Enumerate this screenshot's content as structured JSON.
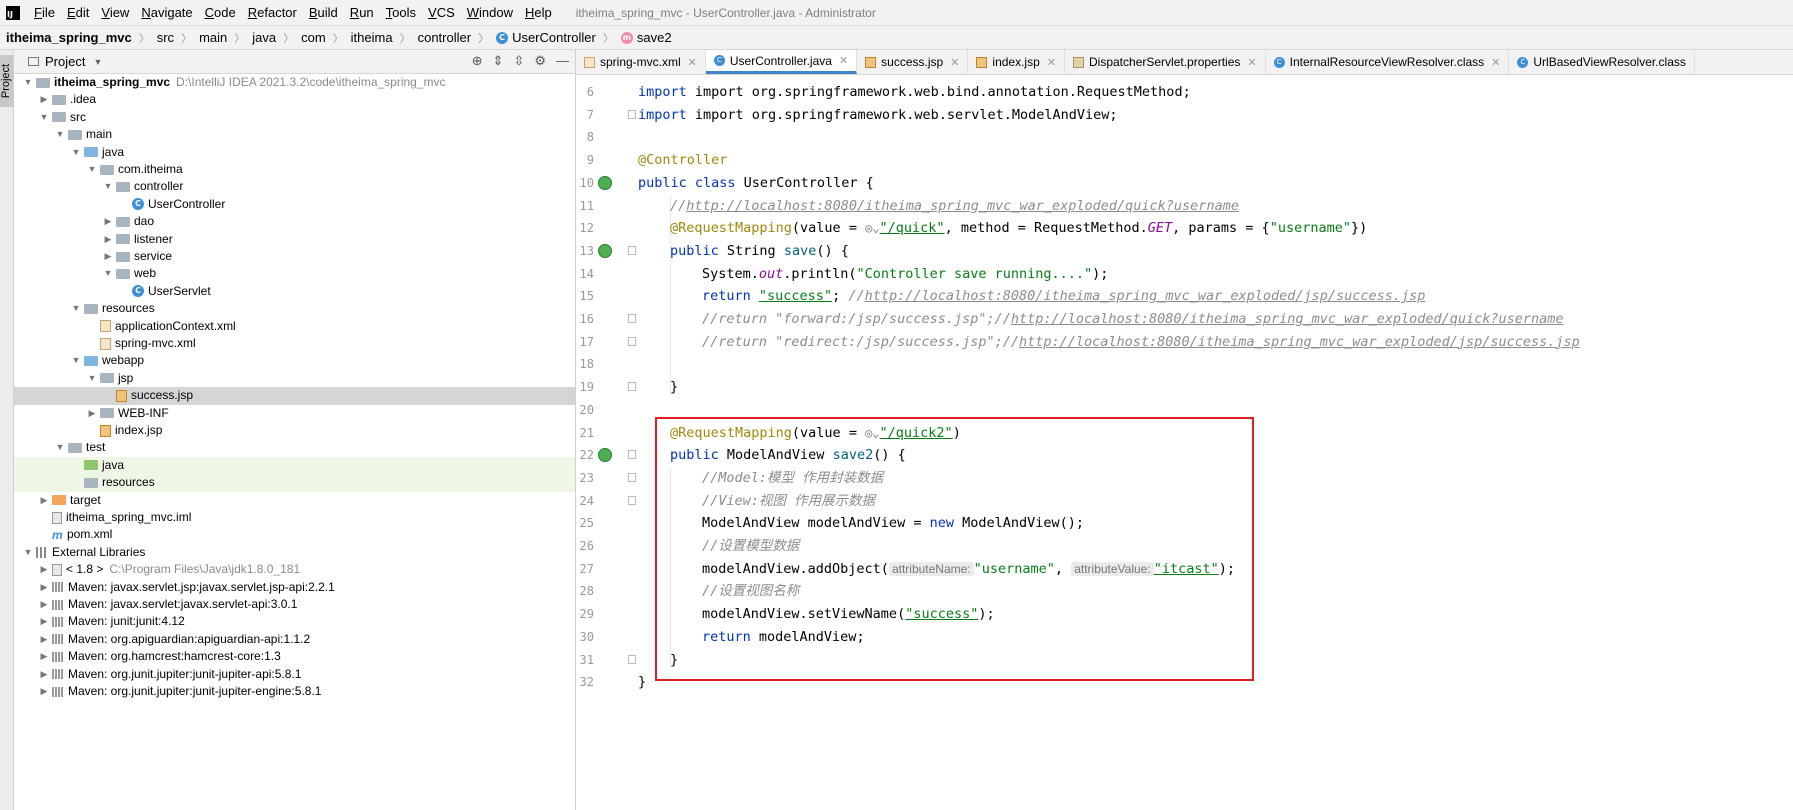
{
  "menu": {
    "logo": "IJ",
    "items": [
      "File",
      "Edit",
      "View",
      "Navigate",
      "Code",
      "Refactor",
      "Build",
      "Run",
      "Tools",
      "VCS",
      "Window",
      "Help"
    ],
    "window_title": "itheima_spring_mvc - UserController.java - Administrator"
  },
  "breadcrumb": [
    "itheima_spring_mvc",
    "src",
    "main",
    "java",
    "com",
    "itheima",
    "controller",
    "UserController",
    "save2"
  ],
  "side_strip": {
    "label": "Project"
  },
  "project_panel": {
    "title": "Project"
  },
  "tree": [
    {
      "label": "itheima_spring_mvc",
      "extra": "D:\\IntelliJ IDEA 2021.3.2\\code\\itheima_spring_mvc"
    },
    {
      "label": ".idea"
    },
    {
      "label": "src"
    },
    {
      "label": "main"
    },
    {
      "label": "java"
    },
    {
      "label": "com.itheima"
    },
    {
      "label": "controller"
    },
    {
      "label": "UserController"
    },
    {
      "label": "dao"
    },
    {
      "label": "listener"
    },
    {
      "label": "service"
    },
    {
      "label": "web"
    },
    {
      "label": "UserServlet"
    },
    {
      "label": "resources"
    },
    {
      "label": "applicationContext.xml"
    },
    {
      "label": "spring-mvc.xml"
    },
    {
      "label": "webapp"
    },
    {
      "label": "jsp"
    },
    {
      "label": "success.jsp"
    },
    {
      "label": "WEB-INF"
    },
    {
      "label": "index.jsp"
    },
    {
      "label": "test"
    },
    {
      "label": "java"
    },
    {
      "label": "resources"
    },
    {
      "label": "target"
    },
    {
      "label": "itheima_spring_mvc.iml"
    },
    {
      "label": "pom.xml"
    },
    {
      "label": "External Libraries"
    },
    {
      "label": "< 1.8 >",
      "extra": "C:\\Program Files\\Java\\jdk1.8.0_181"
    },
    {
      "label": "Maven: javax.servlet.jsp:javax.servlet.jsp-api:2.2.1"
    },
    {
      "label": "Maven: javax.servlet:javax.servlet-api:3.0.1"
    },
    {
      "label": "Maven: junit:junit:4.12"
    },
    {
      "label": "Maven: org.apiguardian:apiguardian-api:1.1.2"
    },
    {
      "label": "Maven: org.hamcrest:hamcrest-core:1.3"
    },
    {
      "label": "Maven: org.junit.jupiter:junit-jupiter-api:5.8.1"
    },
    {
      "label": "Maven: org.junit.jupiter:junit-jupiter-engine:5.8.1"
    }
  ],
  "tabs": [
    "spring-mvc.xml",
    "UserController.java",
    "success.jsp",
    "index.jsp",
    "DispatcherServlet.properties",
    "InternalResourceViewResolver.class",
    "UrlBasedViewResolver.class"
  ],
  "line_numbers": [
    "6",
    "7",
    "8",
    "9",
    "10",
    "11",
    "12",
    "13",
    "14",
    "15",
    "16",
    "17",
    "18",
    "19",
    "20",
    "21",
    "22",
    "23",
    "24",
    "25",
    "26",
    "27",
    "28",
    "29",
    "30",
    "31",
    "32"
  ],
  "code": {
    "l6": "import org.springframework.web.bind.annotation.RequestMethod;",
    "l7": "import org.springframework.web.servlet.ModelAndView;",
    "l9": "@Controller",
    "l10_kw": "public class ",
    "l10_name": "UserController {",
    "l11_cmt": "//",
    "l11_link": "http://localhost:8080/itheima_spring_mvc_war_exploded/quick?username",
    "l12_ann": "@RequestMapping",
    "l12_a": "(value = ",
    "l12_hint": "\"/quick\"",
    "l12_b": ", method = RequestMethod.",
    "l12_get": "GET",
    "l12_c": ", params = {",
    "l12_str": "\"username\"",
    "l12_d": "})",
    "l13_kw": "public ",
    "l13_type": "String ",
    "l13_fn": "save",
    "l13_rest": "() {",
    "l14_a": "System.",
    "l14_out": "out",
    "l14_b": ".println(",
    "l14_str": "\"Controller save running....\"",
    "l14_c": ");",
    "l15_kw": "return ",
    "l15_str": "\"success\"",
    "l15_semi": "; ",
    "l15_cmt": "//",
    "l15_link": "http://localhost:8080/itheima_spring_mvc_war_exploded/jsp/success.jsp",
    "l16_cmt": "//return \"forward:/jsp/success.jsp\";//",
    "l16_link": "http://localhost:8080/itheima_spring_mvc_war_exploded/quick?username",
    "l17_cmt": "//return \"redirect:/jsp/success.jsp\";//",
    "l17_link": "http://localhost:8080/itheima_spring_mvc_war_exploded/jsp/success.jsp",
    "l19": "}",
    "l21_ann": "@RequestMapping",
    "l21_a": "(value = ",
    "l21_str": "\"/quick2\"",
    "l21_b": ")",
    "l22_kw": "public ",
    "l22_type": "ModelAndView ",
    "l22_fn": "save2",
    "l22_rest": "() {",
    "l23": "//Model:模型 作用封装数据",
    "l24": "//View:视图 作用展示数据",
    "l25_a": "ModelAndView modelAndView = ",
    "l25_kw": "new ",
    "l25_b": "ModelAndView();",
    "l26": "//设置模型数据",
    "l27_a": "modelAndView.addObject(",
    "l27_hint1": "attributeName:",
    "l27_str1": "\"username\"",
    "l27_b": ", ",
    "l27_hint2": "attributeValue:",
    "l27_str2": "\"itcast\"",
    "l27_c": ");",
    "l28": "//设置视图名称",
    "l29_a": "modelAndView.setViewName(",
    "l29_str": "\"success\"",
    "l29_b": ");",
    "l30_kw": "return ",
    "l30_b": "modelAndView;",
    "l31": "}",
    "l32": "}"
  },
  "colors": {
    "highlight_box": "#e02020",
    "accent": "#4083c9"
  }
}
